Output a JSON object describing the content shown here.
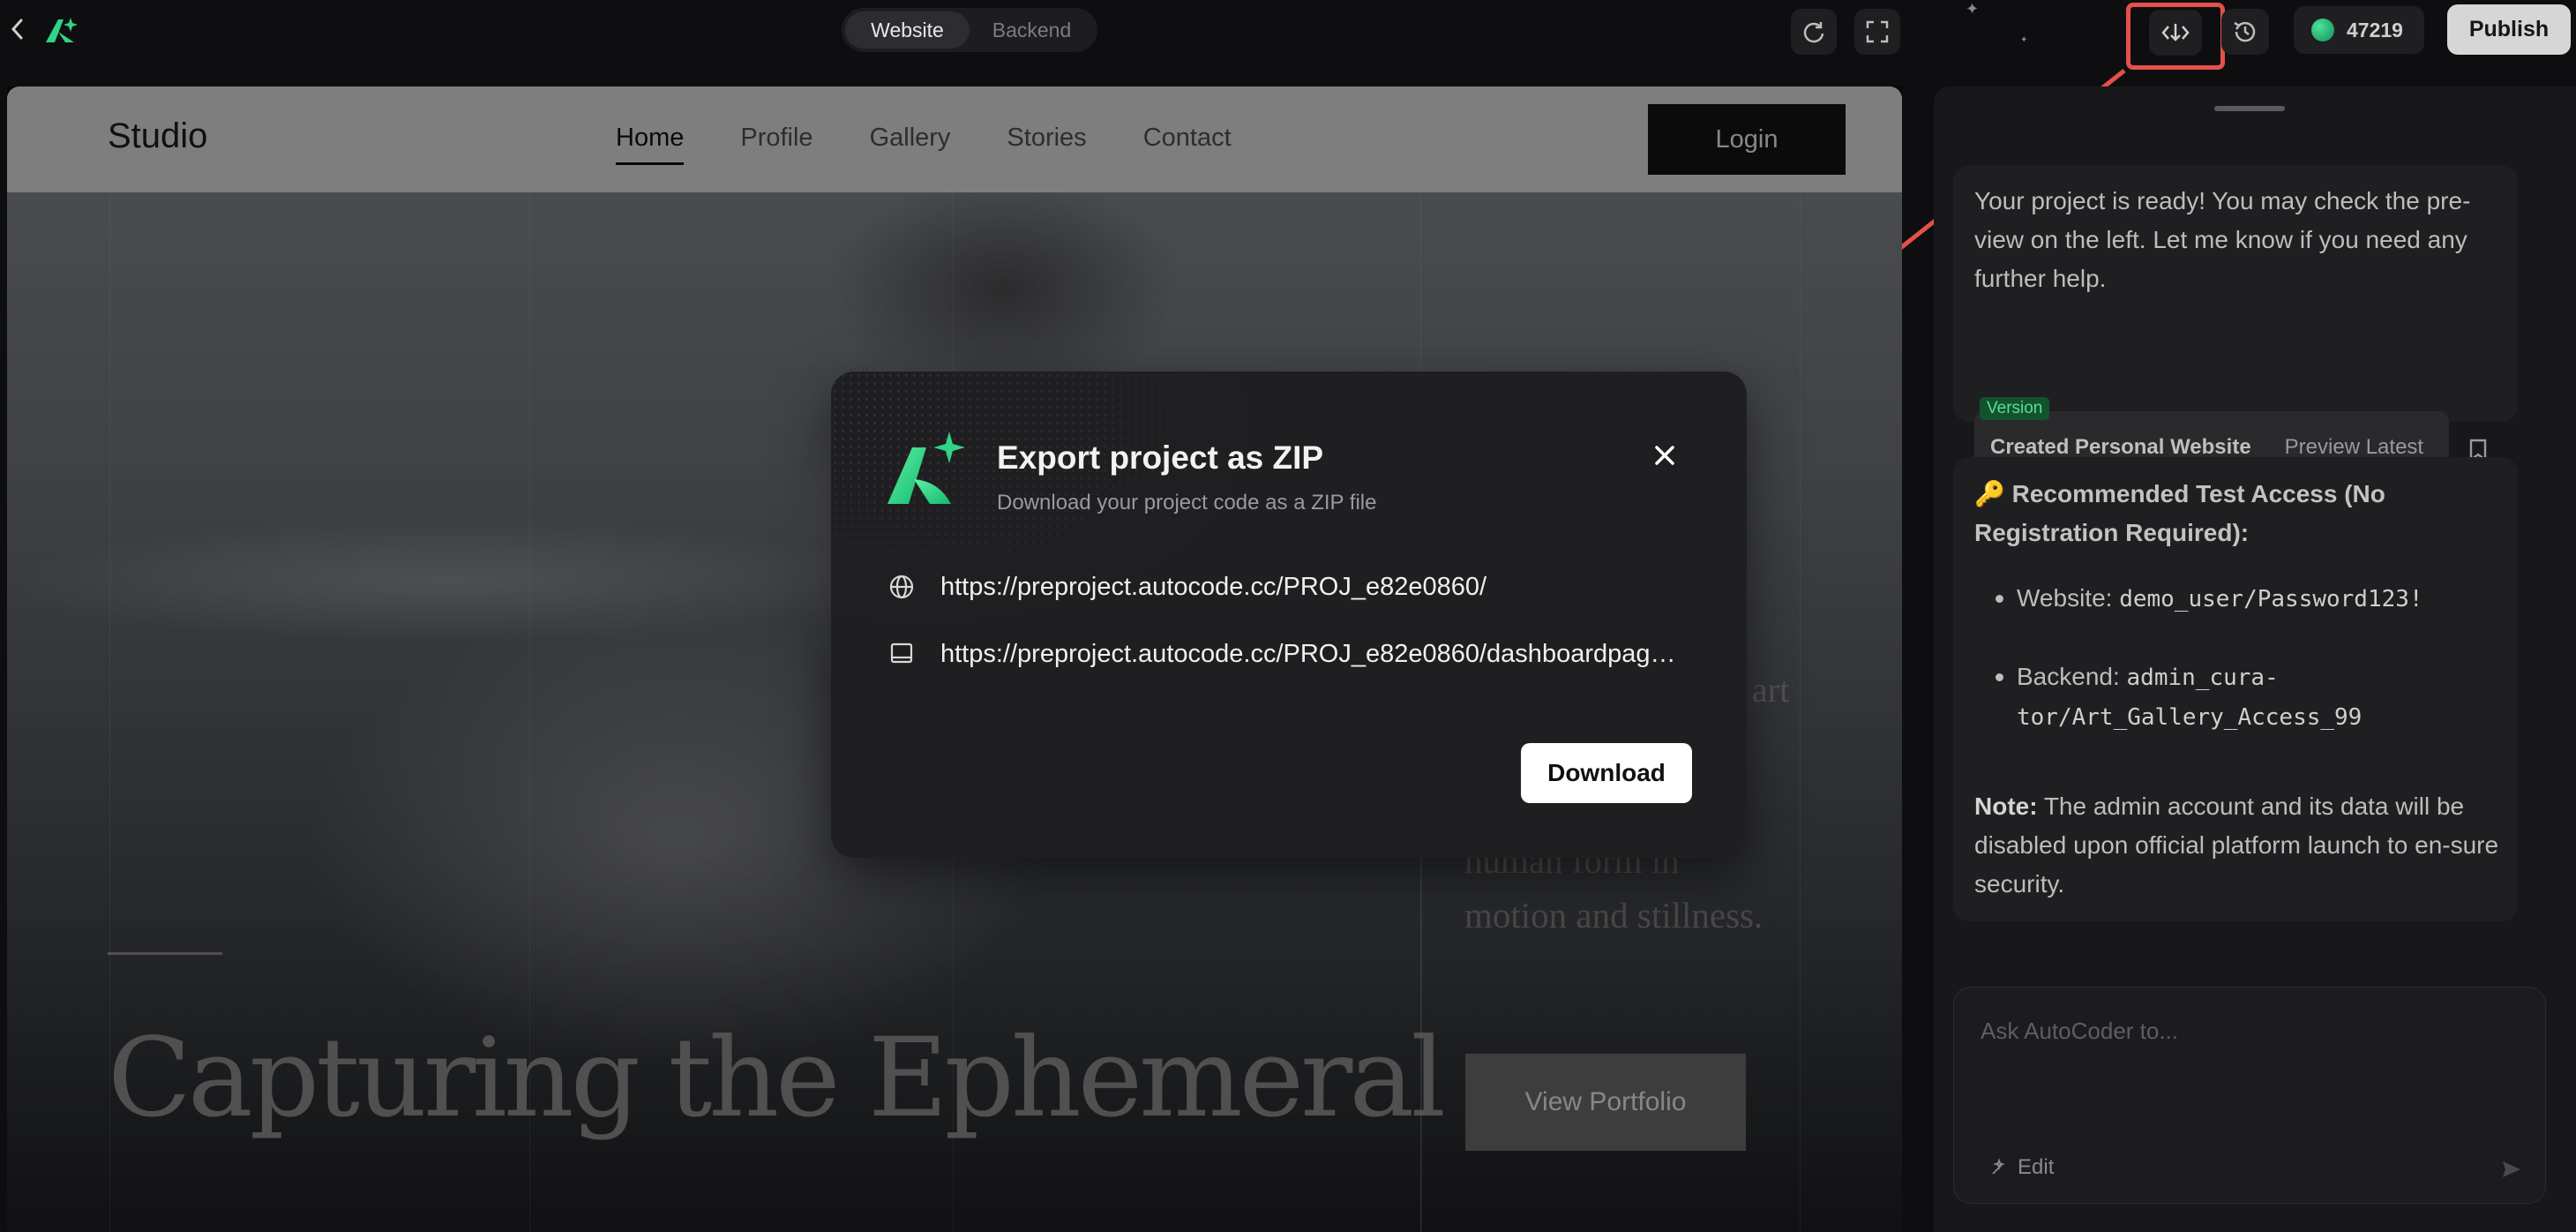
{
  "topbar": {
    "mode_tabs": [
      {
        "label": "Website",
        "active": true
      },
      {
        "label": "Backend",
        "active": false
      }
    ],
    "credits": "47219",
    "publish_label": "Publish",
    "icons": [
      "chevron-left-icon",
      "app-logo",
      "refresh-icon",
      "fullscreen-icon",
      "export-code-icon",
      "history-icon",
      "credit-coin-icon"
    ]
  },
  "preview": {
    "site_brand": "Studio",
    "nav_items": [
      {
        "label": "Home",
        "active": true
      },
      {
        "label": "Profile",
        "active": false
      },
      {
        "label": "Gallery",
        "active": false
      },
      {
        "label": "Stories",
        "active": false
      },
      {
        "label": "Contact",
        "active": false
      }
    ],
    "login_label": "Login",
    "hero_title": "Capturing the Ephemeral",
    "hero_word": "art",
    "hero_description": "human form in motion and stillness.",
    "cta_label": "View Portfolio"
  },
  "modal": {
    "title": "Export project as ZIP",
    "subtitle": "Download your project code as a ZIP file",
    "links": [
      {
        "icon": "globe-icon",
        "url": "https://preproject.autocode.cc/PROJ_e82e0860/"
      },
      {
        "icon": "laptop-icon",
        "url": "https://preproject.autocode.cc/PROJ_e82e0860/dashboardpag…"
      }
    ],
    "download_label": "Download"
  },
  "chat": {
    "message": "Your project is ready! You may check the pre-view on the left. Let me know if you need any further help.",
    "version_tag": "Version",
    "version_name": "Created Personal Website",
    "version_preview": "Preview Latest",
    "info_title": "🔑 Recommended Test Access (No Registration Required):",
    "access_items": [
      {
        "label": "Website:",
        "value": "demo_user/Password123!"
      },
      {
        "label": "Backend:",
        "value": "admin_cura-tor/Art_Gallery_Access_99"
      }
    ],
    "note_label": "Note:",
    "note_text": " The admin account and its data will be disabled upon official platform launch to en-sure security.",
    "input_placeholder": "Ask AutoCoder to...",
    "edit_label": "Edit"
  },
  "colors": {
    "highlight": "#e5504b",
    "accent_green": "#2fd587",
    "panel_bg": "#18181a"
  }
}
